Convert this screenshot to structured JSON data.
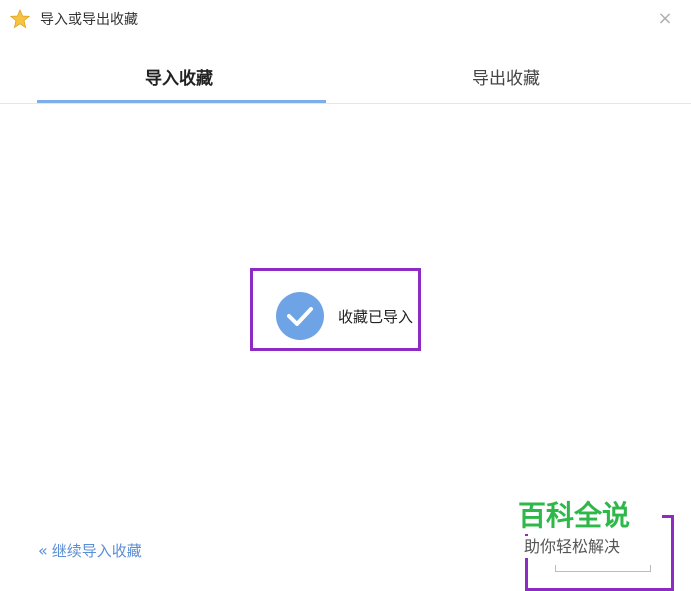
{
  "window": {
    "title": "导入或导出收藏",
    "close_label": "×"
  },
  "tabs": [
    {
      "label": "导入收藏",
      "active": true
    },
    {
      "label": "导出收藏",
      "active": false
    }
  ],
  "status": {
    "message": "收藏已导入"
  },
  "footer": {
    "continue_label": "继续导入收藏",
    "continue_icon": "«"
  },
  "watermark": {
    "logo_text": "百科全说",
    "tagline": "助你轻松解决"
  },
  "colors": {
    "accent": "#7daee8",
    "check": "#6ea3e6",
    "link": "#5a8fd6",
    "highlight_box": "#8e2bc2",
    "watermark_green": "#2fb84a"
  }
}
